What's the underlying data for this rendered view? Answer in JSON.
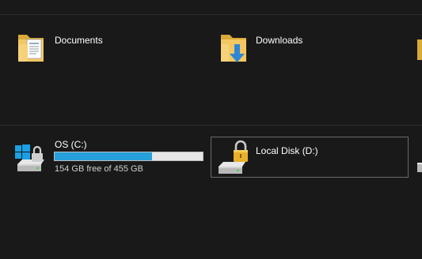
{
  "folders": [
    {
      "label": "Documents",
      "icon": "documents-folder-icon"
    },
    {
      "label": "Downloads",
      "icon": "downloads-folder-icon"
    }
  ],
  "drives": [
    {
      "label": "OS (C:)",
      "icon": "windows-drive-icon",
      "free_text": "154 GB free of 455 GB",
      "used_fraction": 0.66
    },
    {
      "label": "Local Disk (D:)",
      "icon": "locked-drive-icon"
    }
  ],
  "colors": {
    "background": "#191919",
    "bar_fill": "#26a0da",
    "bar_track": "#e6e6e6",
    "selection_border": "#6a6a6a"
  }
}
